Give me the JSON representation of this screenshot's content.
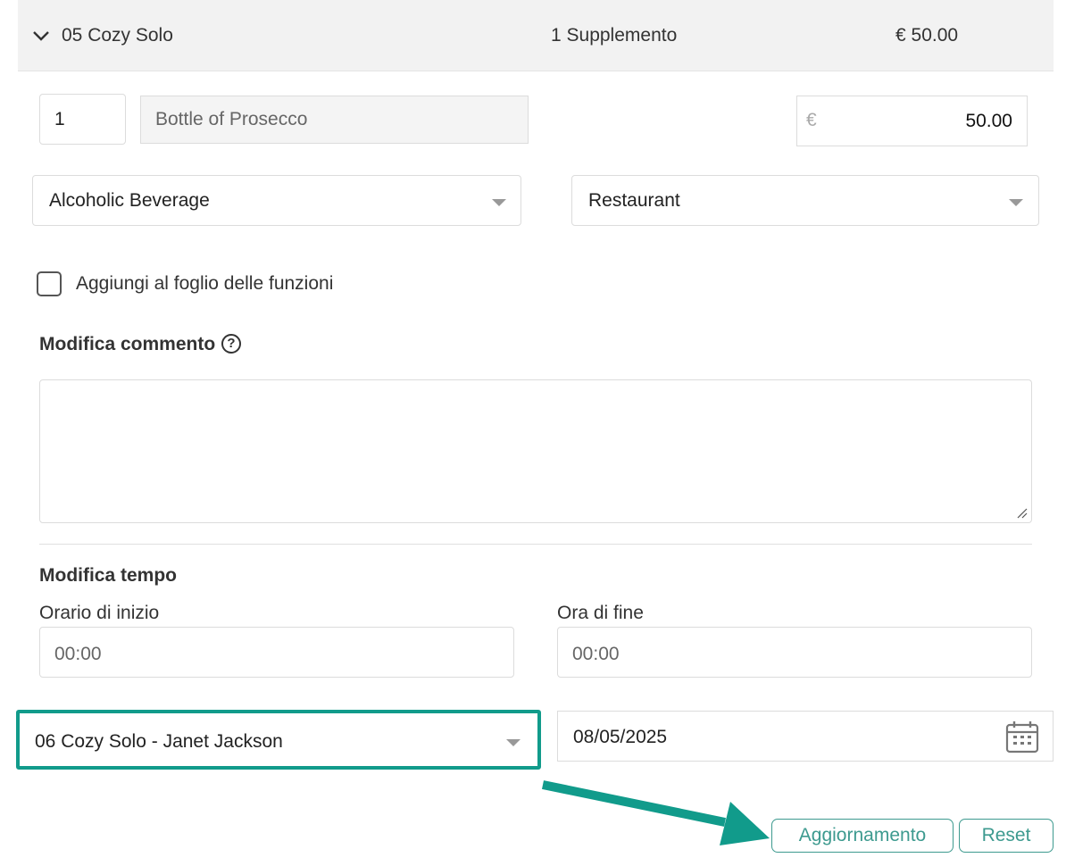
{
  "header": {
    "item_name": "05 Cozy Solo",
    "supplement_count": "1 Supplemento",
    "total_price": "€ 50.00"
  },
  "supplement": {
    "quantity": "1",
    "description": "Bottle of Prosecco",
    "currency_symbol": "€",
    "amount": "50.00",
    "category": "Alcoholic Beverage",
    "outlet": "Restaurant"
  },
  "function_sheet": {
    "checkbox_label": "Aggiungi al foglio delle funzioni",
    "checked": false
  },
  "comment": {
    "heading": "Modifica commento",
    "help_icon": "?",
    "value": ""
  },
  "time": {
    "heading": "Modifica tempo",
    "start_label": "Orario di inizio",
    "start_placeholder": "00:00",
    "end_label": "Ora di fine",
    "end_placeholder": "00:00"
  },
  "room": {
    "selected": "06 Cozy Solo - Janet Jackson",
    "date": "08/05/2025"
  },
  "actions": {
    "update_label": "Aggiornamento",
    "reset_label": "Reset"
  },
  "colors": {
    "accent": "#119b8b",
    "button": "#3d9a8f",
    "header_bg": "#f2f2f2"
  }
}
